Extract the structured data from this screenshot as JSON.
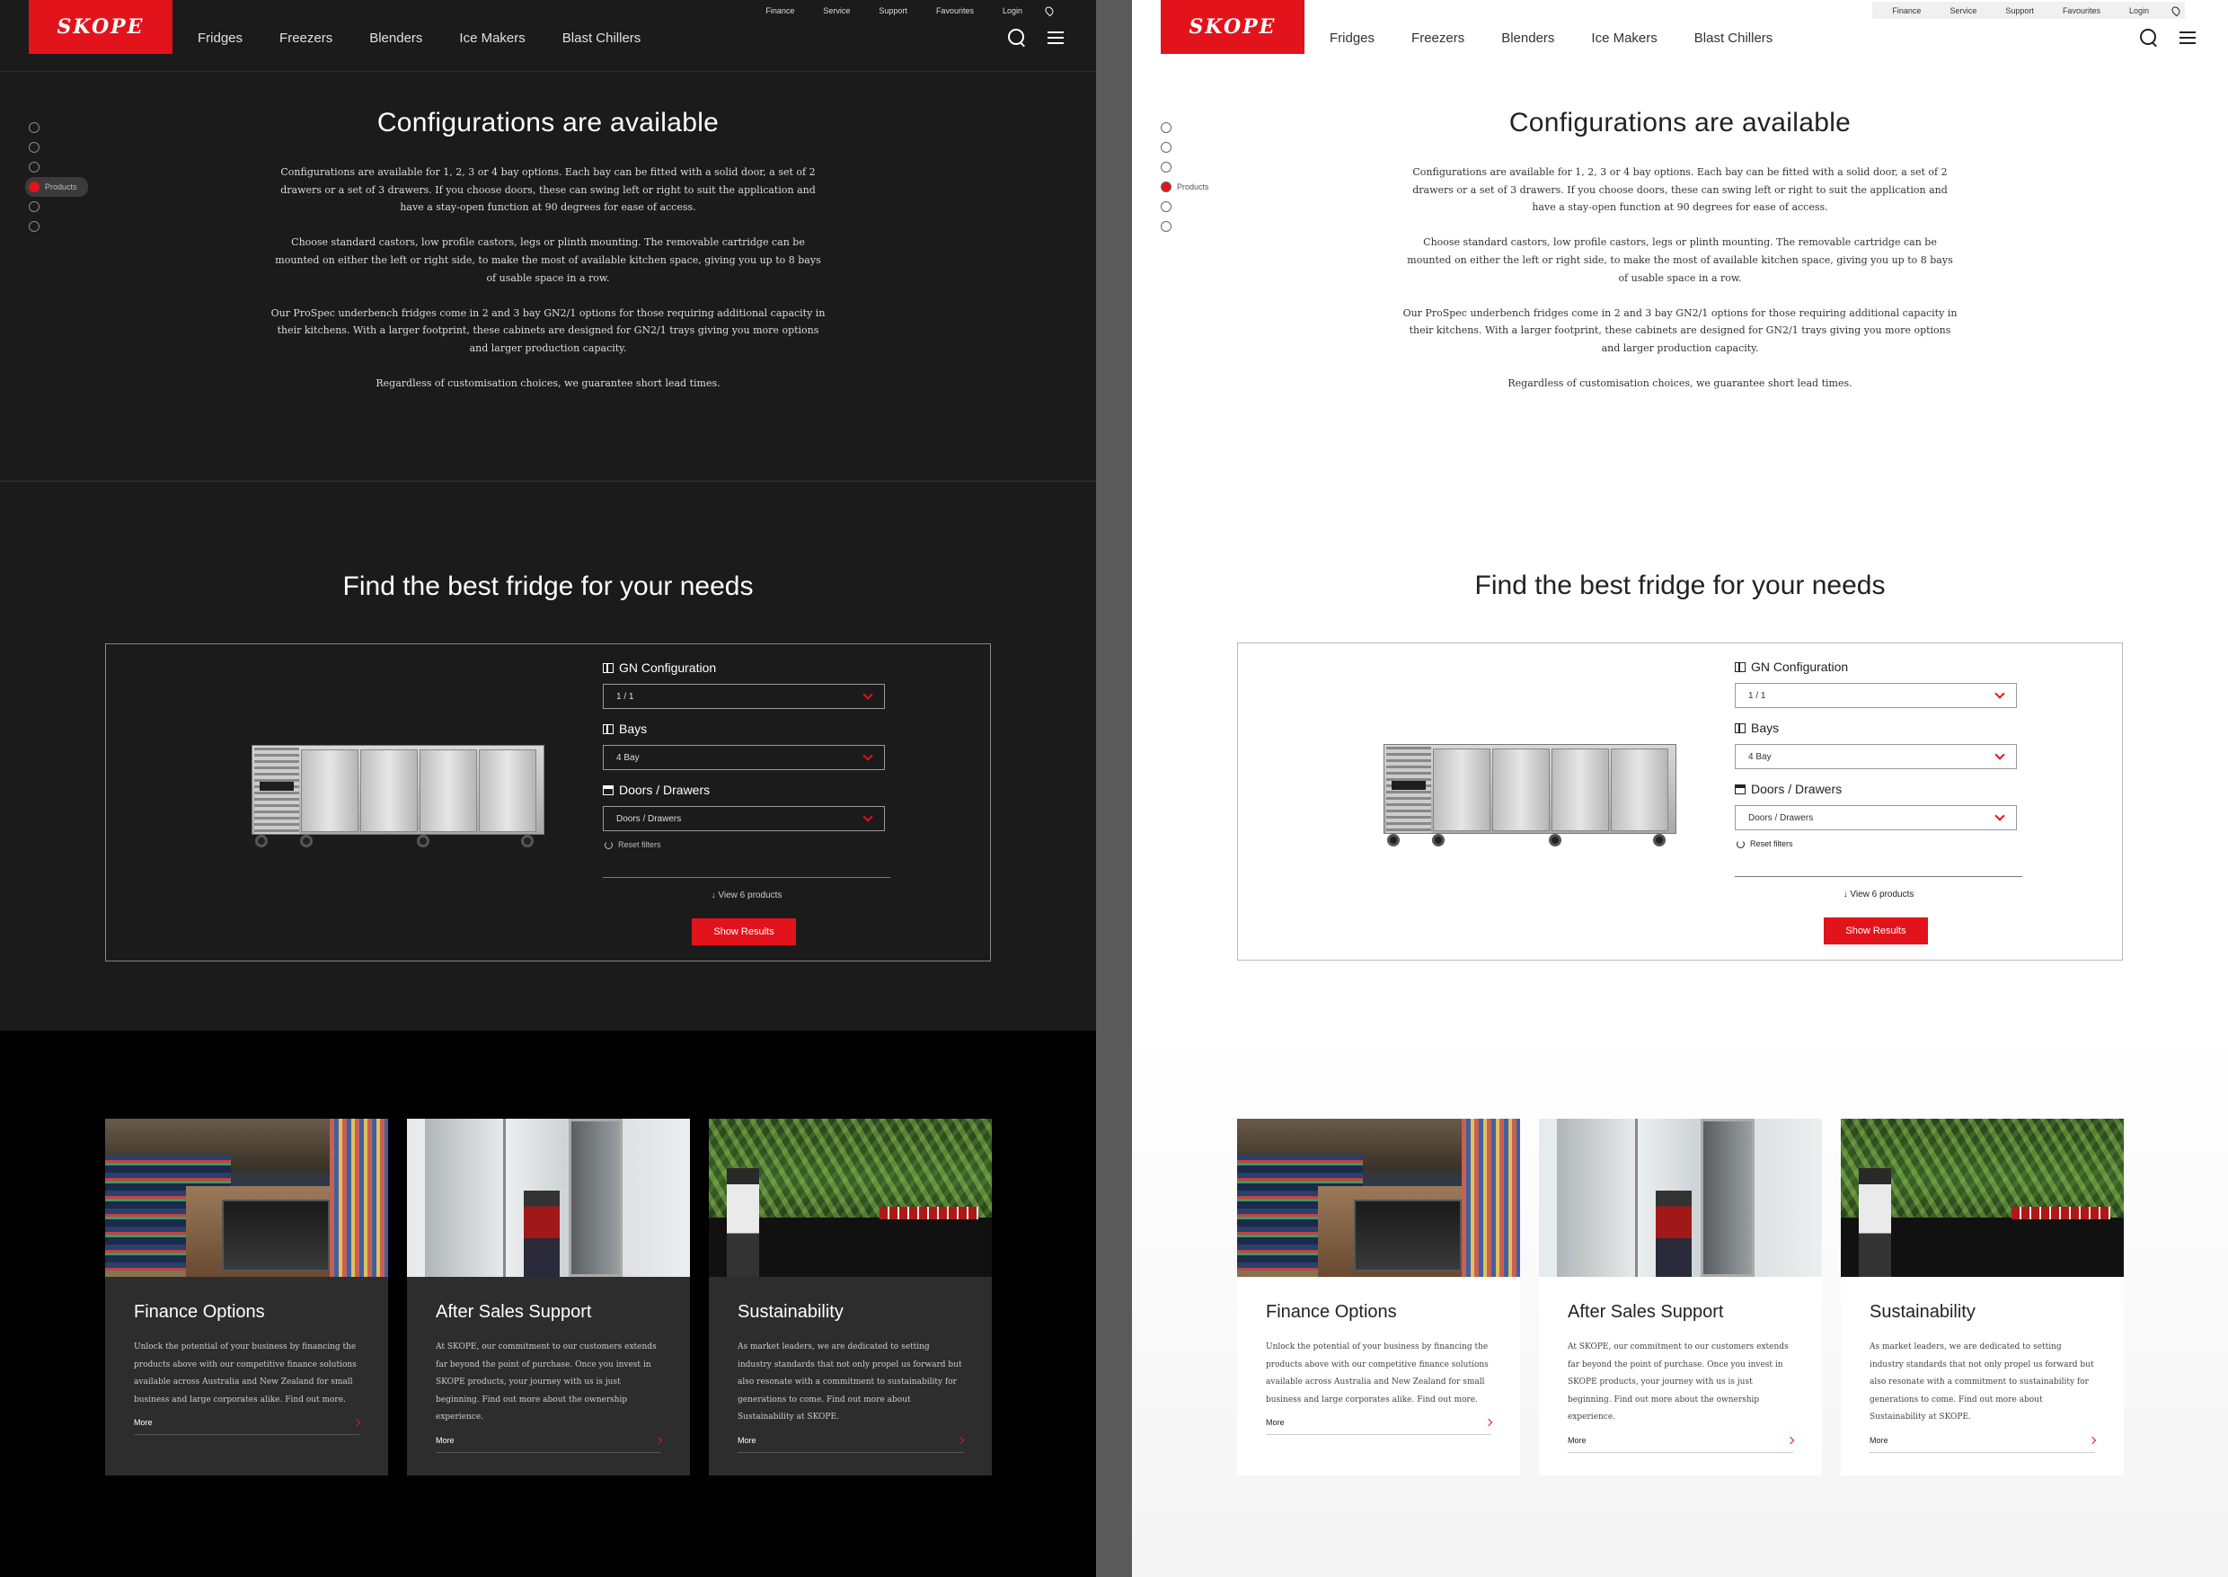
{
  "brand": {
    "logo_text": "SKOPE",
    "accent": "#e2131b"
  },
  "utility_nav": [
    "Finance",
    "Service",
    "Support",
    "Favourites",
    "Login"
  ],
  "main_nav": [
    "Fridges",
    "Freezers",
    "Blenders",
    "Ice Makers",
    "Blast Chillers"
  ],
  "side_nav": {
    "active_label": "Products"
  },
  "config": {
    "title": "Configurations are available",
    "paragraphs": [
      "Configurations are available for 1, 2, 3 or 4 bay options. Each bay can be fitted with a solid door, a set of 2 drawers or a set of 3 drawers. If you choose doors, these can swing left or right to suit the application and have a stay-open function at 90 degrees for ease of access.",
      "Choose standard castors, low profile castors, legs or plinth mounting. The removable cartridge can be mounted on either the left or right side, to make the most of available kitchen space, giving you up to 8 bays of usable space in a row.",
      "Our ProSpec underbench fridges come in 2 and 3 bay GN2/1 options for those requiring additional capacity in their kitchens. With a larger footprint, these cabinets are designed for GN2/1 trays giving you more options and larger production capacity.",
      "Regardless of customisation choices, we guarantee short lead times."
    ]
  },
  "finder": {
    "title": "Find the best fridge for your needs",
    "filters": [
      {
        "label": "GN Configuration",
        "value": "1 / 1"
      },
      {
        "label": "Bays",
        "value": "4 Bay"
      },
      {
        "label": "Doors / Drawers",
        "value": "Doors / Drawers"
      }
    ],
    "reset_label": "Reset filters",
    "view_label": "View 6 products",
    "button_label": "Show Results"
  },
  "cards": [
    {
      "title": "Finance Options",
      "text": "Unlock the potential of your business by financing the products above with our competitive finance solutions available across Australia and New Zealand for small business and large corporates alike. Find out more.",
      "more": "More"
    },
    {
      "title": "After Sales Support",
      "text": "At SKOPE, our commitment to our customers extends far beyond the point of purchase. Once you invest in SKOPE products, your journey with us is just beginning. Find out more about the ownership experience.",
      "more": "More"
    },
    {
      "title": "Sustainability",
      "text": "As market leaders, we are dedicated to setting industry standards that not only propel us forward but also resonate with a commitment to sustainability for generations to come. Find out more about Sustainability at SKOPE.",
      "more": "More"
    }
  ]
}
